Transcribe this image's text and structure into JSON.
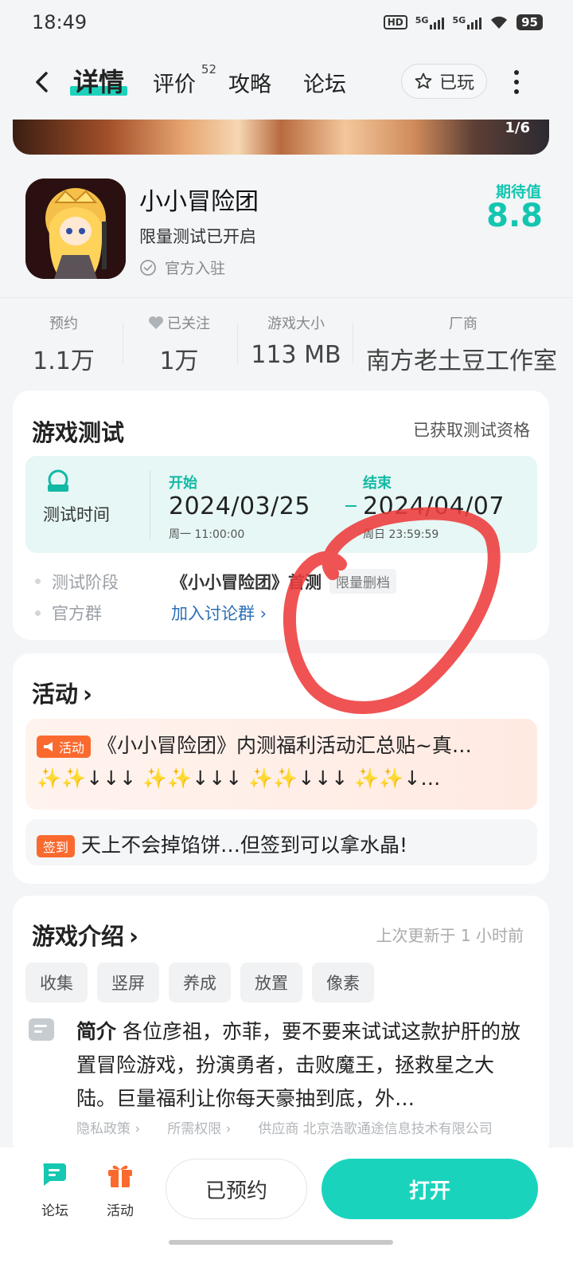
{
  "status_bar": {
    "time": "18:49",
    "hd": "HD",
    "net1": "5G",
    "net2": "5G",
    "battery": "95"
  },
  "nav": {
    "tabs": [
      {
        "label": "详情"
      },
      {
        "label": "评价",
        "count": "52"
      },
      {
        "label": "攻略"
      },
      {
        "label": "论坛"
      }
    ],
    "played_label": "已玩"
  },
  "banner": {
    "page_indicator": "1/6"
  },
  "app": {
    "title": "小小冒险团",
    "subtitle": "限量测试已开启",
    "verified": "官方入驻",
    "expect_label": "期待值",
    "expect_score": "8.8"
  },
  "stats": [
    {
      "label": "预约",
      "value": "1.1万"
    },
    {
      "label": "已关注",
      "value": "1万"
    },
    {
      "label": "游戏大小",
      "value": "113 MB"
    },
    {
      "label": "厂商",
      "value": "南方老土豆工作室"
    }
  ],
  "test_card": {
    "title": "游戏测试",
    "status": "已获取测试资格",
    "beta_label": "测试时间",
    "start_label": "开始",
    "start_date": "2024/03/25",
    "start_sub": "周一  11:00:00",
    "end_label": "结束",
    "end_date": "2024/04/07",
    "end_sub": "周日  23:59:59",
    "stage_label": "测试阶段",
    "stage_value": "《小小冒险团》首测",
    "stage_tag": "限量删档",
    "group_label": "官方群",
    "group_value": "加入讨论群"
  },
  "activity_card": {
    "title": "活动",
    "promo1_badge": "活动",
    "promo1_line1": "《小小冒险团》内测福利活动汇总贴~真…",
    "promo1_line2": "✨✨↓↓↓ ✨✨↓↓↓ ✨✨↓↓↓ ✨✨↓…",
    "promo2_badge": "签到",
    "promo2_text": "天上不会掉馅饼…但签到可以拿水晶!"
  },
  "intro_card": {
    "title": "游戏介绍",
    "updated": "上次更新于 1 小时前",
    "tags": [
      "收集",
      "竖屏",
      "养成",
      "放置",
      "像素"
    ],
    "desc_label": "简介",
    "desc_text": "各位彦祖，亦菲，要不要来试试这款护肝的放置冒险游戏，扮演勇者，击败魔王，拯救星之大陆。巨量福利让你每天豪抽到底，外…",
    "privacy": "隐私政策 ›",
    "permissions": "所需权限 ›",
    "supplier": "供应商 北京浩歌通途信息技术有限公司"
  },
  "bottom_bar": {
    "forum": "论坛",
    "activity": "活动",
    "reserved": "已预约",
    "open": "打开"
  },
  "colors": {
    "accent": "#1ad3bc",
    "promo_orange": "#fa6a2e",
    "link_blue": "#2d6fb6",
    "annotation_red": "#ee3b3b"
  }
}
